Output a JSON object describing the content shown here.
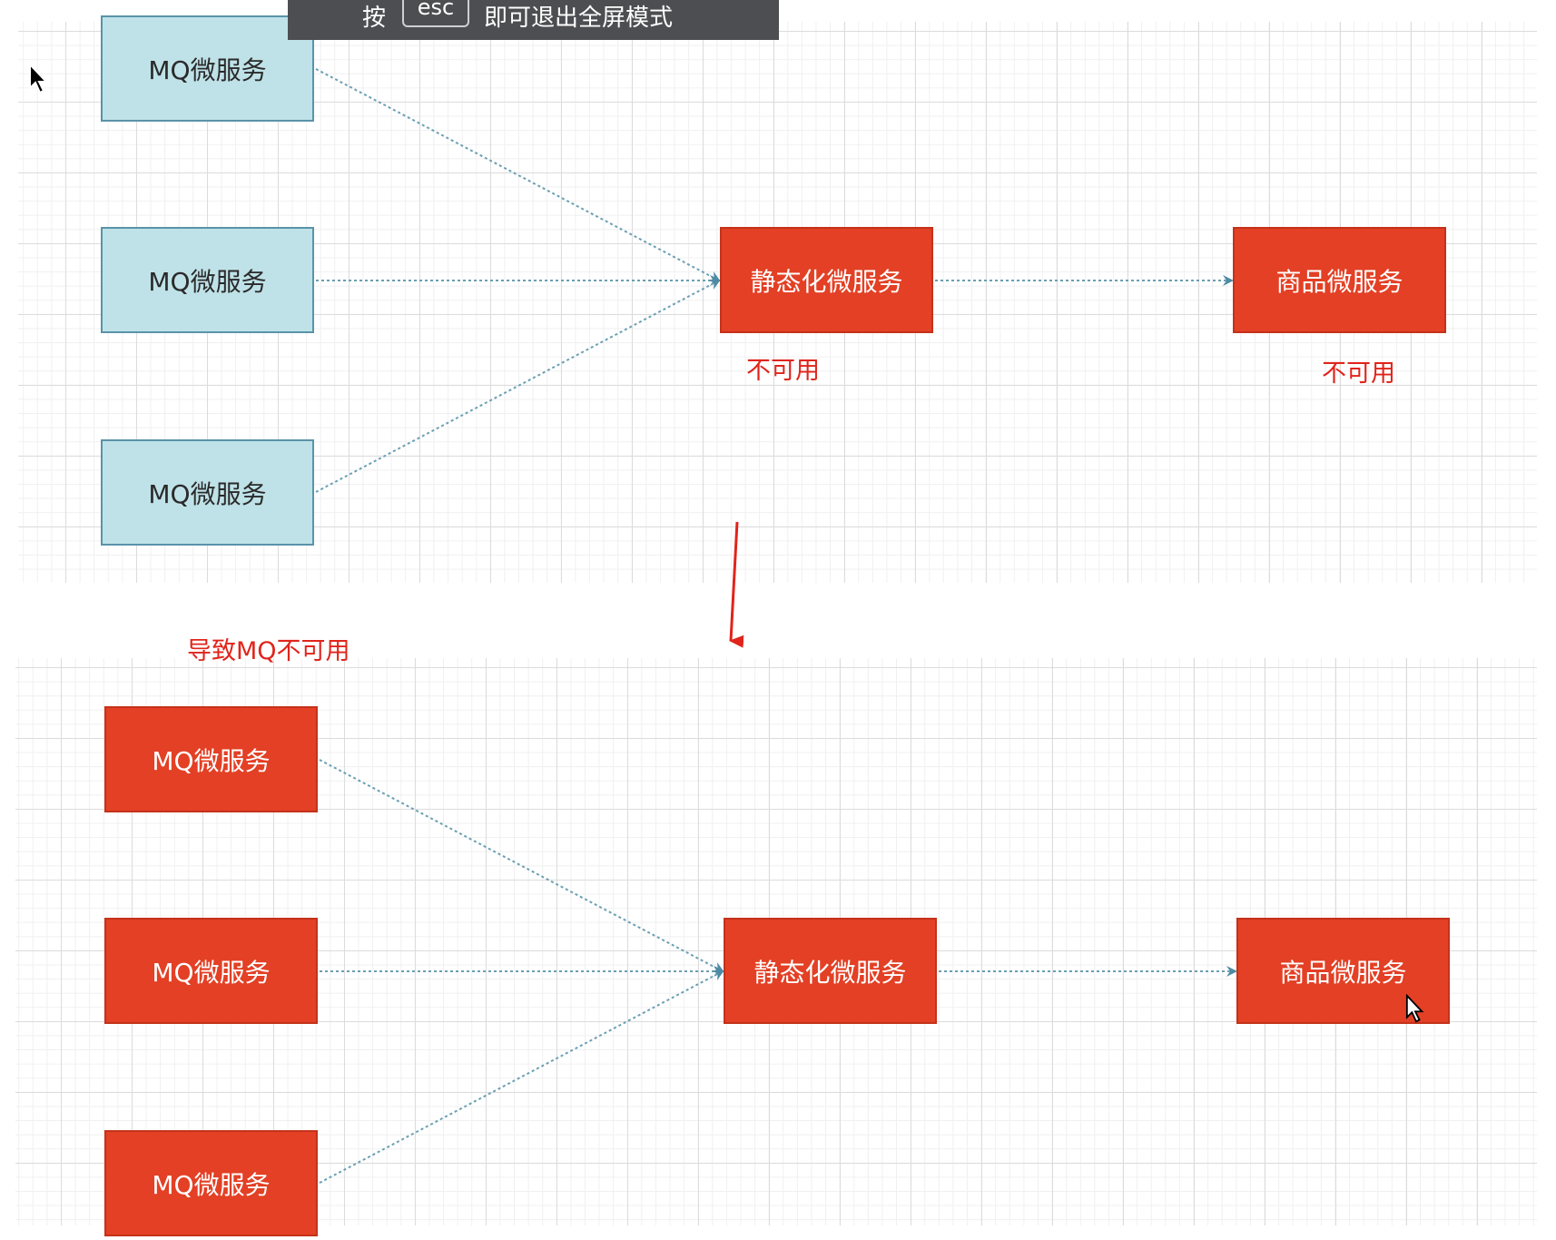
{
  "toast": {
    "prefix": "按",
    "key": "esc",
    "suffix": "即可退出全屏模式"
  },
  "top_diagram": {
    "sources": [
      {
        "label": "MQ微服务"
      },
      {
        "label": "MQ微服务"
      },
      {
        "label": "MQ微服务"
      }
    ],
    "static_service": {
      "label": "静态化微服务",
      "status": "不可用"
    },
    "product_service": {
      "label": "商品微服务",
      "status": "不可用"
    }
  },
  "annotation": "导致MQ不可用",
  "bottom_diagram": {
    "sources": [
      {
        "label": "MQ微服务"
      },
      {
        "label": "MQ微服务"
      },
      {
        "label": "MQ微服务"
      }
    ],
    "static_service": {
      "label": "静态化微服务"
    },
    "product_service": {
      "label": "商品微服务"
    }
  },
  "colors": {
    "available_fill": "#bfe2e8",
    "unavailable_fill": "#e34025",
    "connector": "#5a93a9",
    "annotation_red": "#e0241b"
  }
}
